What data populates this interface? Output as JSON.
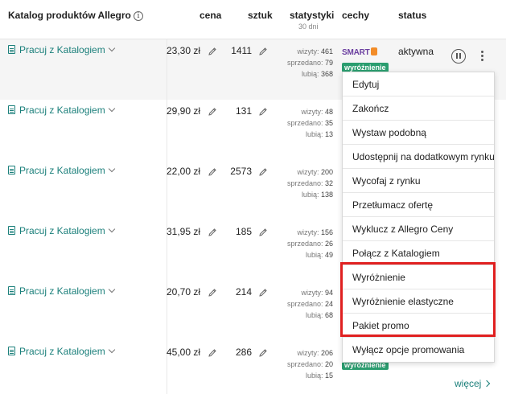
{
  "header": {
    "katalog": "Katalog produktów Allegro",
    "cena": "cena",
    "sztuk": "sztuk",
    "statystyki": "statystyki",
    "statystyki_sub": "30 dni",
    "cechy": "cechy",
    "status": "status"
  },
  "labels": {
    "wizyty": "wizyty:",
    "sprzedano": "sprzedano:",
    "lubia": "lubią:"
  },
  "rows": [
    {
      "catalog": "Pracuj z Katalogiem",
      "price": "23,30 zł",
      "qty": "1411",
      "wizyty": "461",
      "sprzedano": "79",
      "lubia": "368",
      "smart": "SMART",
      "badge": "wyróżnienie",
      "status": "aktywna"
    },
    {
      "catalog": "Pracuj z Katalogiem",
      "price": "29,90 zł",
      "qty": "131",
      "wizyty": "48",
      "sprzedano": "35",
      "lubia": "13"
    },
    {
      "catalog": "Pracuj z Katalogiem",
      "price": "22,00 zł",
      "qty": "2573",
      "wizyty": "200",
      "sprzedano": "32",
      "lubia": "138"
    },
    {
      "catalog": "Pracuj z Katalogiem",
      "price": "31,95 zł",
      "qty": "185",
      "wizyty": "156",
      "sprzedano": "26",
      "lubia": "49"
    },
    {
      "catalog": "Pracuj z Katalogiem",
      "price": "20,70 zł",
      "qty": "214",
      "wizyty": "94",
      "sprzedano": "24",
      "lubia": "68"
    },
    {
      "catalog": "Pracuj z Katalogiem",
      "price": "45,00 zł",
      "qty": "286",
      "wizyty": "206",
      "sprzedano": "20",
      "lubia": "15",
      "badge": "wyróżnienie"
    }
  ],
  "menu": {
    "items": [
      "Edytuj",
      "Zakończ",
      "Wystaw podobną",
      "Udostępnij na dodatkowym rynku",
      "Wycofaj z rynku",
      "Przetłumacz ofertę",
      "Wyklucz z Allegro Ceny",
      "Połącz z Katalogiem",
      "Wyróżnienie",
      "Wyróżnienie elastyczne",
      "Pakiet promo",
      "Wyłącz opcje promowania"
    ]
  },
  "more": "więcej",
  "colors": {
    "accent": "#1a7f7a",
    "badge": "#2a9d6f",
    "highlight": "#e02020",
    "smart": "#6b3fa0"
  },
  "icons": {
    "info": "info-icon",
    "doc": "document-icon",
    "chevron": "chevron-down-icon",
    "pencil": "pencil-icon",
    "pause": "pause-icon",
    "kebab": "kebab-icon"
  }
}
